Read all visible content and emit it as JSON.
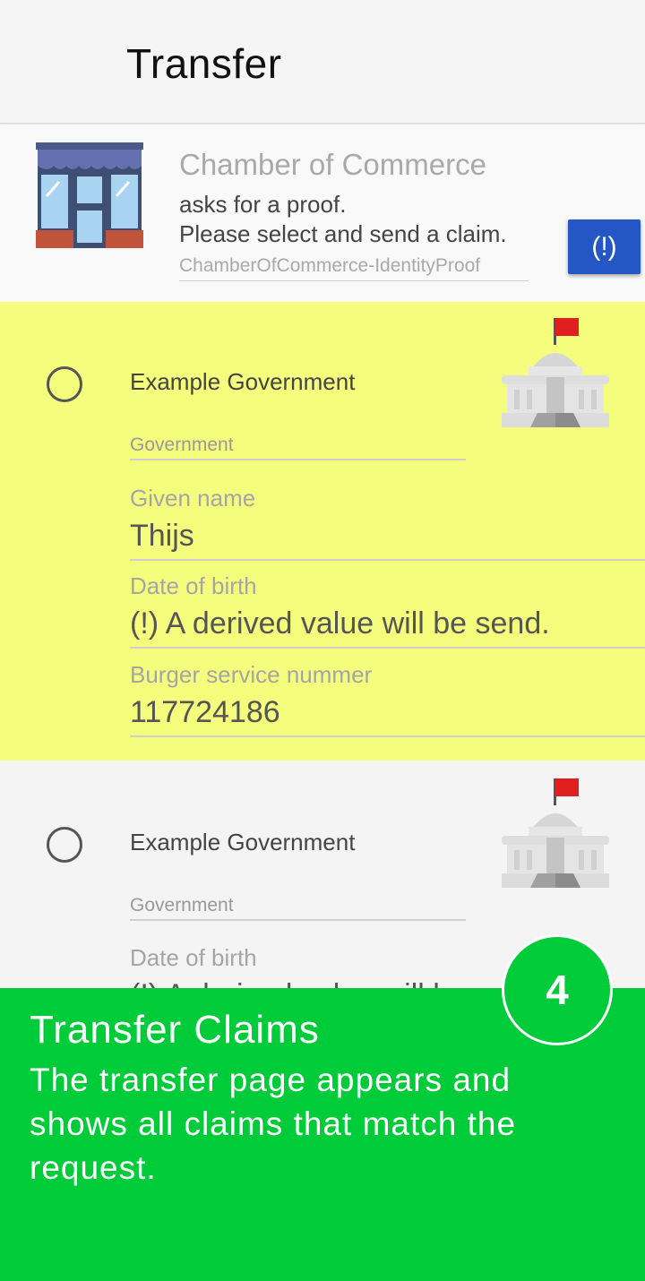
{
  "appbar": {
    "title": "Transfer"
  },
  "request": {
    "organization": "Chamber of Commerce",
    "line1": "asks for a proof.",
    "line2": "Please select and send a claim.",
    "proof_type": "ChamberOfCommerce-IdentityProof",
    "info_button_label": "(!)",
    "icon": "storefront-icon"
  },
  "claims": [
    {
      "issuer": "Example Government",
      "type": "Government",
      "icon": "government-building-icon",
      "fields": [
        {
          "label": "Given name",
          "value": "Thijs"
        },
        {
          "label": "Date of birth",
          "value": "(!) A derived value will be send."
        },
        {
          "label": "Burger service nummer",
          "value": "117724186"
        }
      ]
    },
    {
      "issuer": "Example Government",
      "type": "Government",
      "icon": "government-building-icon",
      "fields": [
        {
          "label": "Date of birth",
          "value": "(!) A derived value will be send."
        }
      ]
    }
  ],
  "tutorial": {
    "step": "4",
    "title": "Transfer Claims",
    "text": "The transfer page appears and shows all claims that match the request."
  },
  "colors": {
    "selected_card": "#f4fe7c",
    "info_button": "#2457c5",
    "overlay": "#00cc3a"
  }
}
